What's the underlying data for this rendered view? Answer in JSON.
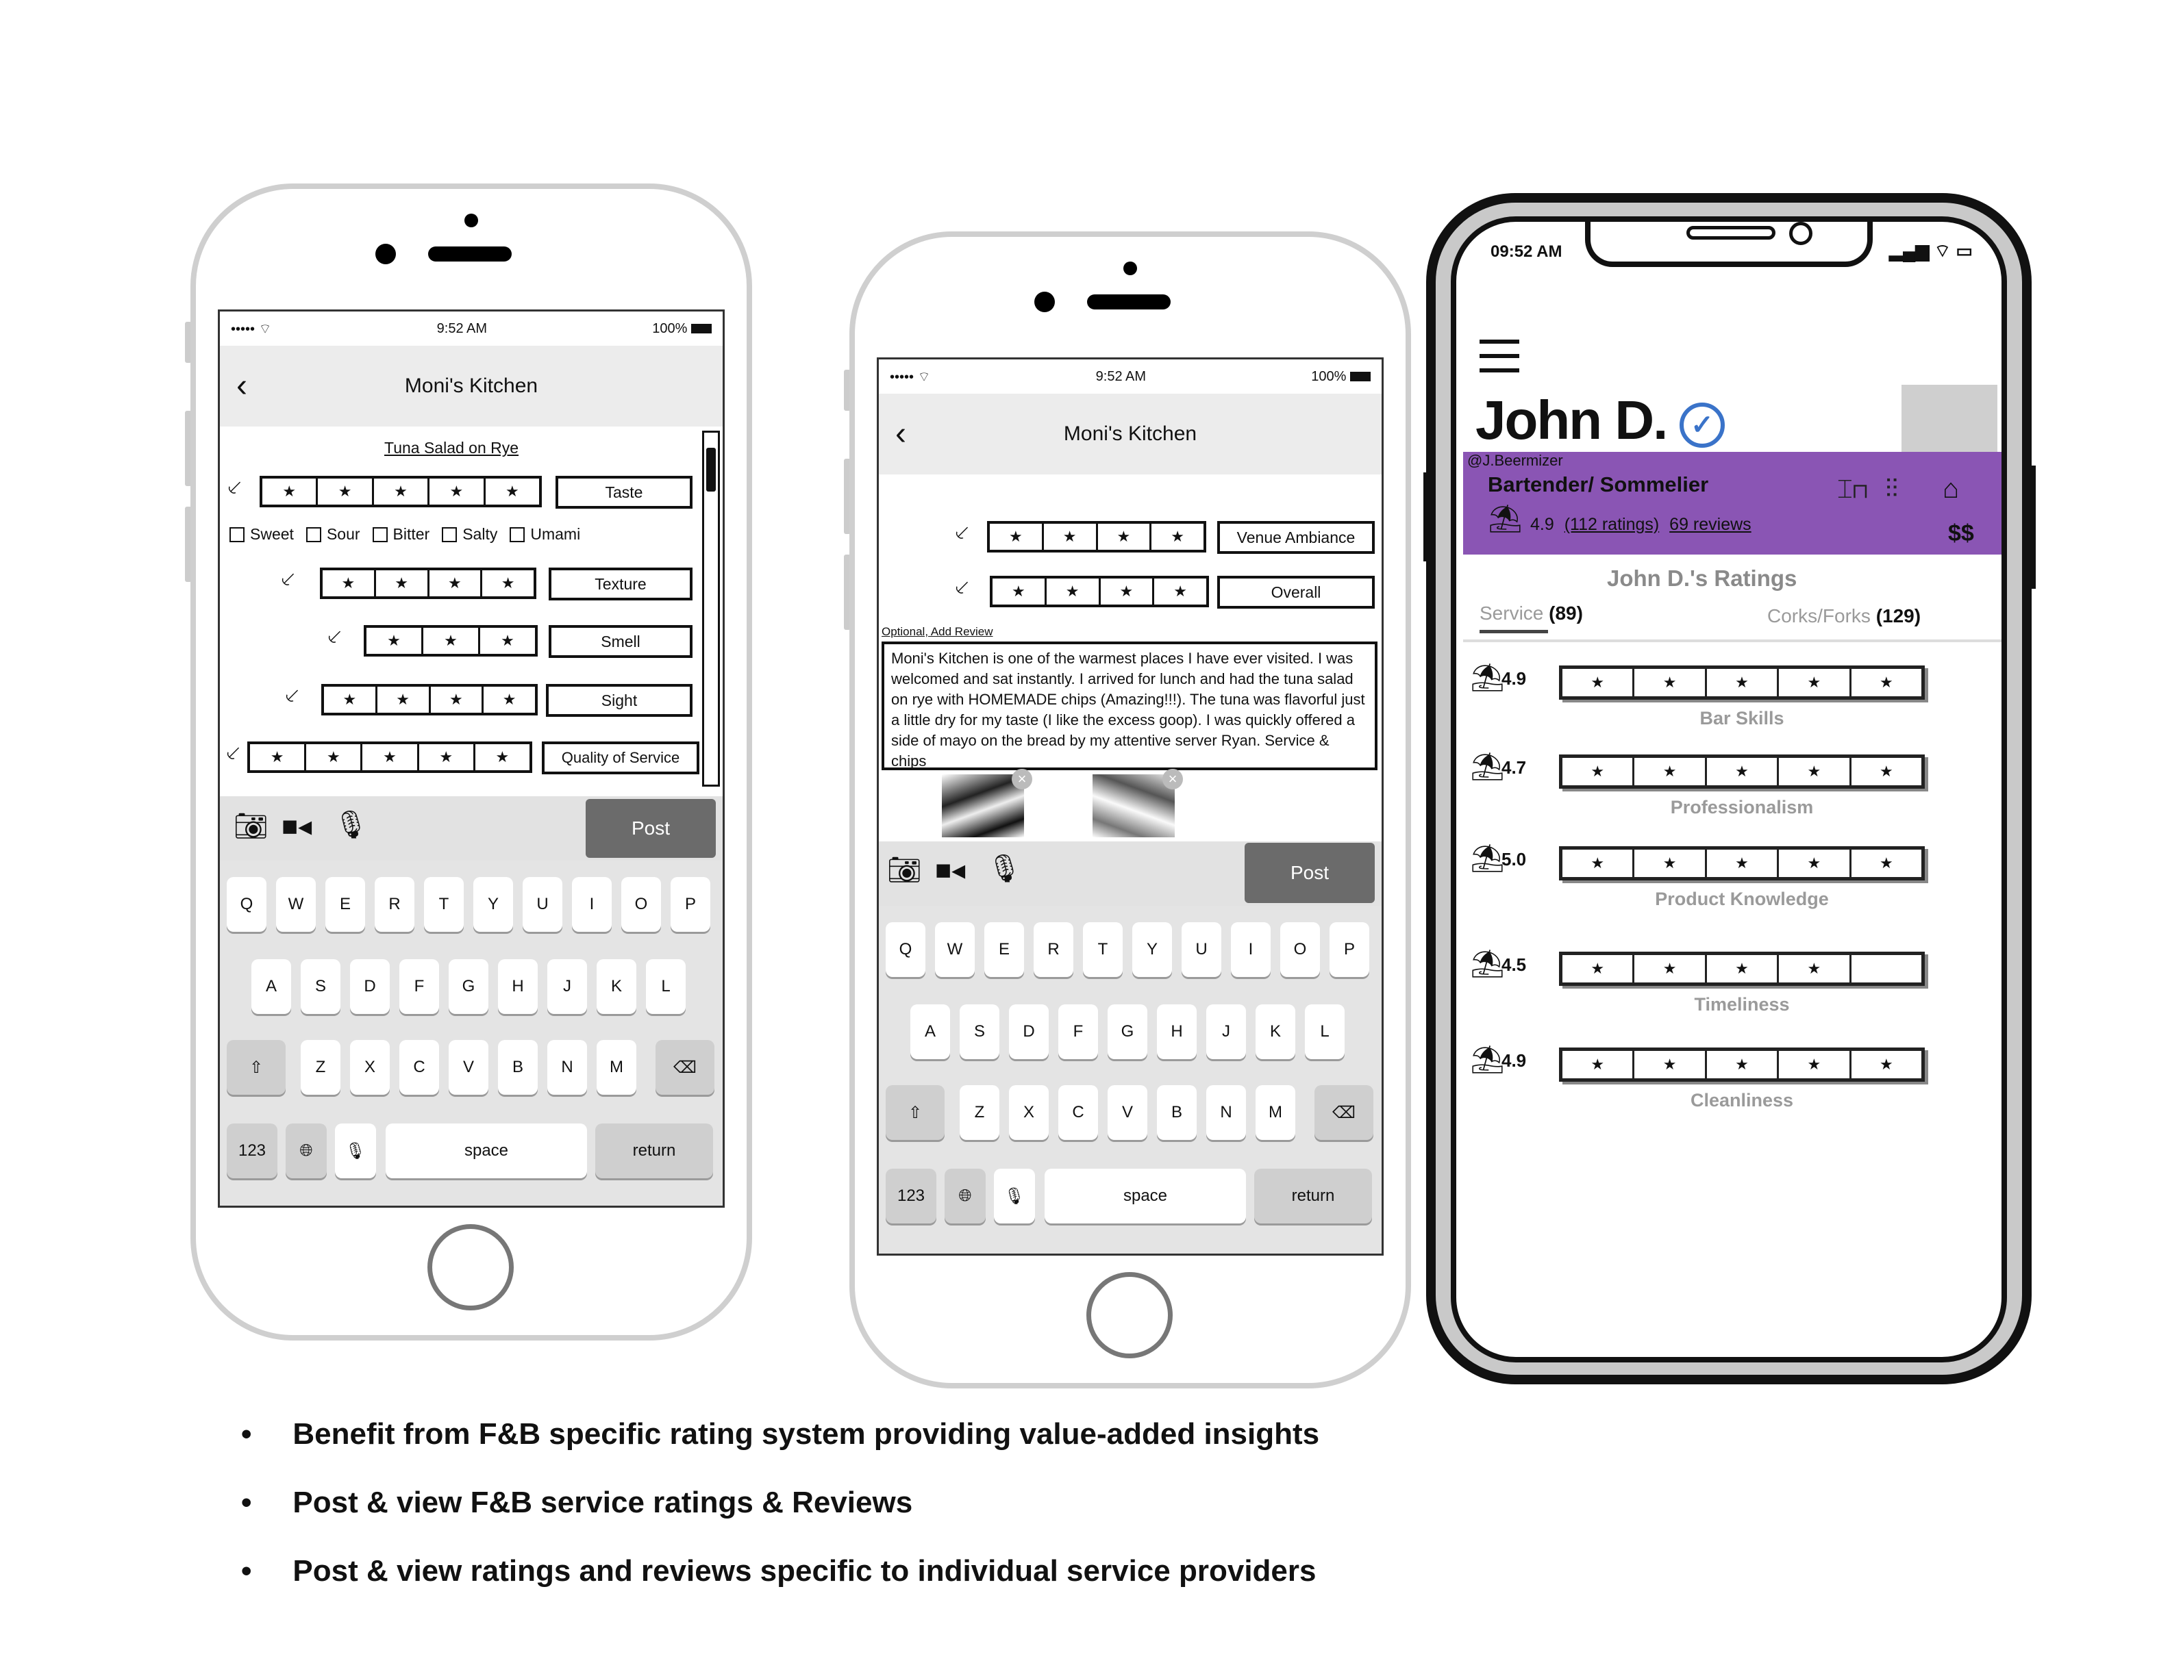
{
  "left_phone": {
    "status": {
      "carrier": "••••• ",
      "time": "9:52 AM",
      "battery": "100%"
    },
    "title": "Moni's Kitchen",
    "dish": "Tuna Salad on Rye",
    "taste_label": "Taste",
    "flavors": [
      "Sweet",
      "Sour",
      "Bitter",
      "Salty",
      "Umami"
    ],
    "texture_label": "Texture",
    "smell_label": "Smell",
    "sight_label": "Sight",
    "service_label": "Quality of Service",
    "post_label": "Post"
  },
  "middle_phone": {
    "status": {
      "carrier": "••••• ",
      "time": "9:52 AM",
      "battery": "100%"
    },
    "title": "Moni's Kitchen",
    "ambiance_label": "Venue Ambiance",
    "overall_label": "Overall",
    "optional_label": "Optional, Add Review",
    "review_text": "Moni's Kitchen is one of the warmest places I have ever visited.  I was welcomed and sat instantly. I arrived for lunch and had the tuna salad on rye with HOMEMADE chips (Amazing!!!). The tuna was flavorful just a little dry for my taste (I like the excess goop). I was quickly offered a side of mayo on the bread by my attentive server Ryan. Service & chips",
    "post_label": "Post"
  },
  "keyboard": {
    "row1": [
      "Q",
      "W",
      "E",
      "R",
      "T",
      "Y",
      "U",
      "I",
      "O",
      "P"
    ],
    "row2": [
      "A",
      "S",
      "D",
      "F",
      "G",
      "H",
      "J",
      "K",
      "L"
    ],
    "row3": [
      "Z",
      "X",
      "C",
      "V",
      "B",
      "N",
      "M"
    ],
    "num_label": "123",
    "space_label": "space",
    "return_label": "return"
  },
  "right_phone": {
    "time": "09:52 AM",
    "name": "John D.",
    "handle": "@J.Beermizer",
    "role": "Bartender/ Sommelier",
    "rating": "4.9",
    "ratings_count": "(112 ratings)",
    "reviews_count": "69 reviews",
    "price": "$$",
    "accent_color": "#8a55b4",
    "section_title": "John D.'s Ratings",
    "tab_service": "Service",
    "tab_service_count": "(89)",
    "tab_corks": "Corks/Forks",
    "tab_corks_count": "(129)",
    "categories": [
      {
        "score": "4.9",
        "label": "Bar Skills",
        "stars": 5
      },
      {
        "score": "4.7",
        "label": "Professionalism",
        "stars": 5
      },
      {
        "score": "5.0",
        "label": "Product Knowledge",
        "stars": 5
      },
      {
        "score": "4.5",
        "label": "Timeliness",
        "stars": 4
      },
      {
        "score": "4.9",
        "label": "Cleanliness",
        "stars": 5
      }
    ]
  },
  "bullets": [
    "Benefit from F&B specific rating system providing value-added insights",
    "Post & view F&B service ratings & Reviews",
    "Post & view ratings and reviews specific to individual service providers"
  ]
}
